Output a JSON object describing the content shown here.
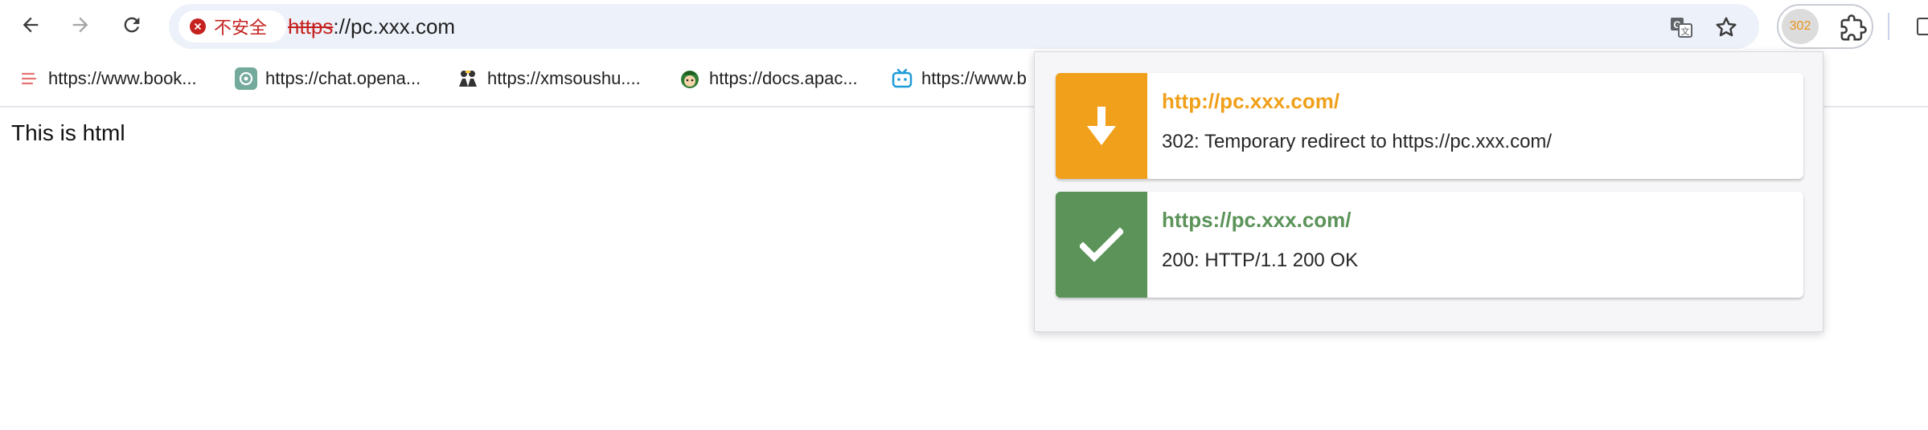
{
  "browser": {
    "url_scheme": "https",
    "url_rest": "://pc.xxx.com",
    "security_label": "不安全",
    "extension_badge": "302"
  },
  "bookmarks": [
    {
      "label": "https://www.book...",
      "icon": "book-icon"
    },
    {
      "label": "https://chat.opena...",
      "icon": "openai-icon"
    },
    {
      "label": "https://xmsoushu....",
      "icon": "people-icon"
    },
    {
      "label": "https://docs.apac...",
      "icon": "green-face-icon"
    },
    {
      "label": "https://www.b",
      "icon": "bilibili-icon"
    }
  ],
  "page": {
    "body_text": "This is html"
  },
  "redirect_popup": {
    "entries": [
      {
        "url": "http://pc.xxx.com/",
        "status": "302: Temporary redirect to https://pc.xxx.com/",
        "color": "#f0a01a",
        "icon": "arrow-down-icon"
      },
      {
        "url": "https://pc.xxx.com/",
        "status": "200: HTTP/1.1 200 OK",
        "color": "#5b9359",
        "icon": "checkmark-icon"
      }
    ]
  },
  "colors": {
    "insecure_red": "#c5221f",
    "redirect_orange": "#f0a01a",
    "ok_green": "#5b9359"
  }
}
